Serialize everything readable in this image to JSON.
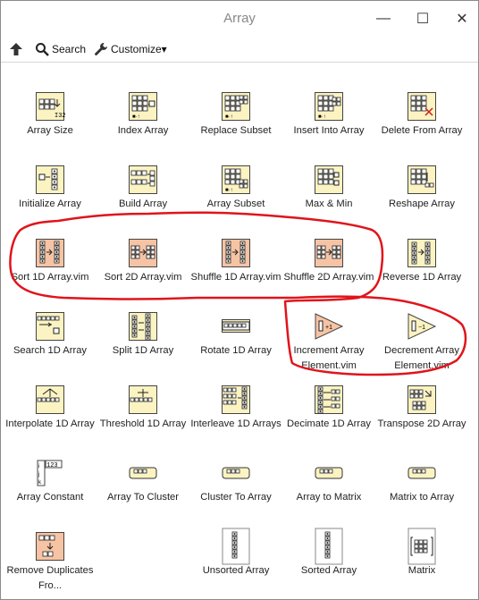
{
  "window": {
    "title": "Array",
    "minimize": "—",
    "maximize": "☐",
    "close": "✕"
  },
  "toolbar": {
    "search_label": "Search",
    "customize_label": "Customize▾"
  },
  "palette": {
    "items": [
      {
        "label": "Array Size",
        "icon": "array-size-icon"
      },
      {
        "label": "Index Array",
        "icon": "index-array-icon"
      },
      {
        "label": "Replace Subset",
        "icon": "replace-subset-icon"
      },
      {
        "label": "Insert Into Array",
        "icon": "insert-into-array-icon"
      },
      {
        "label": "Delete From Array",
        "icon": "delete-from-array-icon"
      },
      {
        "label": "Initialize Array",
        "icon": "initialize-array-icon"
      },
      {
        "label": "Build Array",
        "icon": "build-array-icon"
      },
      {
        "label": "Array Subset",
        "icon": "array-subset-icon"
      },
      {
        "label": "Max & Min",
        "icon": "max-min-icon"
      },
      {
        "label": "Reshape Array",
        "icon": "reshape-array-icon"
      },
      {
        "label": "Sort 1D Array.vim",
        "icon": "sort-1d-array-icon"
      },
      {
        "label": "Sort 2D Array.vim",
        "icon": "sort-2d-array-icon"
      },
      {
        "label": "Shuffle 1D Array.vim",
        "icon": "shuffle-1d-array-icon"
      },
      {
        "label": "Shuffle 2D Array.vim",
        "icon": "shuffle-2d-array-icon"
      },
      {
        "label": "Reverse 1D Array",
        "icon": "reverse-1d-array-icon"
      },
      {
        "label": "Search 1D Array",
        "icon": "search-1d-array-icon"
      },
      {
        "label": "Split 1D Array",
        "icon": "split-1d-array-icon"
      },
      {
        "label": "Rotate 1D Array",
        "icon": "rotate-1d-array-icon"
      },
      {
        "label": "Increment Array Element.vim",
        "icon": "increment-array-element-icon"
      },
      {
        "label": "Decrement Array Element.vim",
        "icon": "decrement-array-element-icon"
      },
      {
        "label": "Interpolate 1D Array",
        "icon": "interpolate-1d-array-icon"
      },
      {
        "label": "Threshold 1D Array",
        "icon": "threshold-1d-array-icon"
      },
      {
        "label": "Interleave 1D Arrays",
        "icon": "interleave-1d-arrays-icon"
      },
      {
        "label": "Decimate 1D Array",
        "icon": "decimate-1d-array-icon"
      },
      {
        "label": "Transpose 2D Array",
        "icon": "transpose-2d-array-icon"
      },
      {
        "label": "Array Constant",
        "icon": "array-constant-icon",
        "icon_text": "123"
      },
      {
        "label": "Array To Cluster",
        "icon": "array-to-cluster-icon"
      },
      {
        "label": "Cluster To Array",
        "icon": "cluster-to-array-icon"
      },
      {
        "label": "Array to Matrix",
        "icon": "array-to-matrix-icon"
      },
      {
        "label": "Matrix to Array",
        "icon": "matrix-to-array-icon"
      },
      {
        "label": "Remove Duplicates Fro...",
        "icon": "remove-duplicates-icon"
      },
      {
        "label": "",
        "icon": ""
      },
      {
        "label": "Unsorted Array",
        "icon": "unsorted-array-folder-icon"
      },
      {
        "label": "Sorted Array",
        "icon": "sorted-array-folder-icon"
      },
      {
        "label": "Matrix",
        "icon": "matrix-folder-icon"
      }
    ]
  },
  "annotation": {
    "color": "#e0141c"
  }
}
